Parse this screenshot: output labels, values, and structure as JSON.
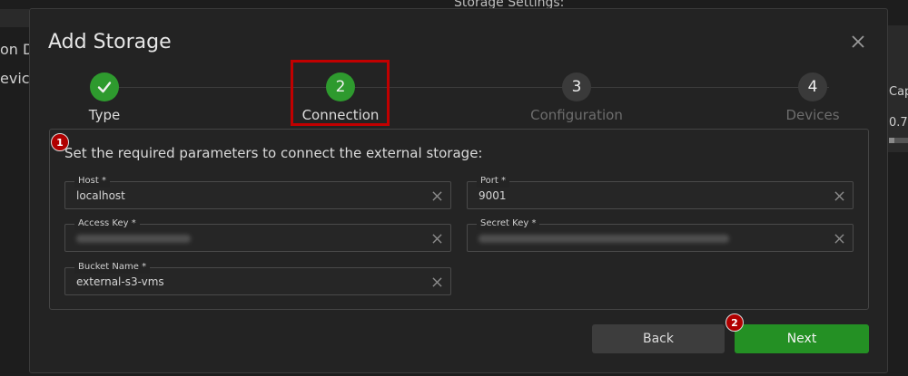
{
  "background": {
    "left_text_1": "on D",
    "left_text_2": "evic",
    "top_text": "Storage Settings:",
    "right_header": "Cap",
    "right_value": "0.7",
    "right_bar_fill": 0.3
  },
  "modal": {
    "title": "Add Storage",
    "close_icon": "close-icon"
  },
  "stepper": {
    "steps": [
      {
        "number": "",
        "label": "Type",
        "state": "done"
      },
      {
        "number": "2",
        "label": "Connection",
        "state": "active"
      },
      {
        "number": "3",
        "label": "Configuration",
        "state": "pending"
      },
      {
        "number": "4",
        "label": "Devices",
        "state": "pending"
      }
    ]
  },
  "form": {
    "heading": "Set the required parameters to connect the external storage:",
    "host": {
      "label": "Host *",
      "value": "localhost"
    },
    "port": {
      "label": "Port *",
      "value": "9001"
    },
    "access_key": {
      "label": "Access Key *",
      "value": ""
    },
    "secret_key": {
      "label": "Secret Key *",
      "value": ""
    },
    "bucket_name": {
      "label": "Bucket Name *",
      "value": "external-s3-vms"
    }
  },
  "annotations": {
    "badge_1": "1",
    "badge_2": "2"
  },
  "buttons": {
    "back_label": "Back",
    "next_label": "Next"
  },
  "colors": {
    "accent_green": "#249024",
    "highlight_red": "#c10000",
    "badge_red": "#b00000"
  }
}
